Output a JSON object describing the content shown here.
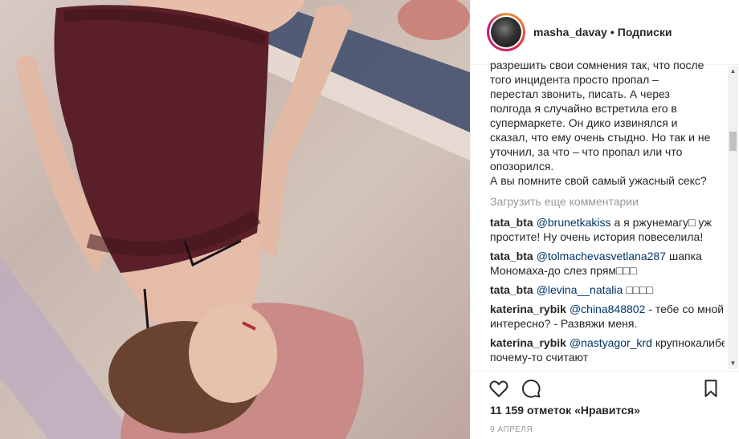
{
  "post": {
    "username": "masha_davay",
    "separator": "•",
    "follow_label": "Подписки"
  },
  "caption_lines": [
    "разрешить свои сомнения так, что после",
    "того инцидента просто пропал –",
    "перестал звонить, писать. А через",
    "полгода я случайно встретила его в",
    "супермаркете. Он дико извинялся и",
    "сказал, что ему очень стыдно. Но так и не",
    "уточнил, за что – что пропал или что",
    "опозорился.",
    "А вы помните свой самый ужасный секс?"
  ],
  "load_more_label": "Загрузить еще комментарии",
  "comments": [
    {
      "user": "tata_bta",
      "mention": "@brunetkakiss",
      "text": "а я ржунемагу□ уж простите! Ну очень история повеселила!"
    },
    {
      "user": "tata_bta",
      "mention": "@tolmachevasvetlana287",
      "text": "шапка Мономаха-до слез прям□□□"
    },
    {
      "user": "tata_bta",
      "mention": "@levina__natalia",
      "text": "□□□□"
    },
    {
      "user": "katerina_rybik",
      "mention": "@china848802",
      "text": "- тебе со мной интересно? - Развяжи меня."
    },
    {
      "user": "katerina_rybik",
      "mention": "@nastyagor_krd",
      "text": "крупнокалиберные почему-то считают"
    }
  ],
  "icons": {
    "like": "heart-icon",
    "comment": "comment-icon",
    "save": "bookmark-icon"
  },
  "likes_text": "11 159 отметок «Нравится»",
  "date_text": "9 АПРЕЛЯ"
}
